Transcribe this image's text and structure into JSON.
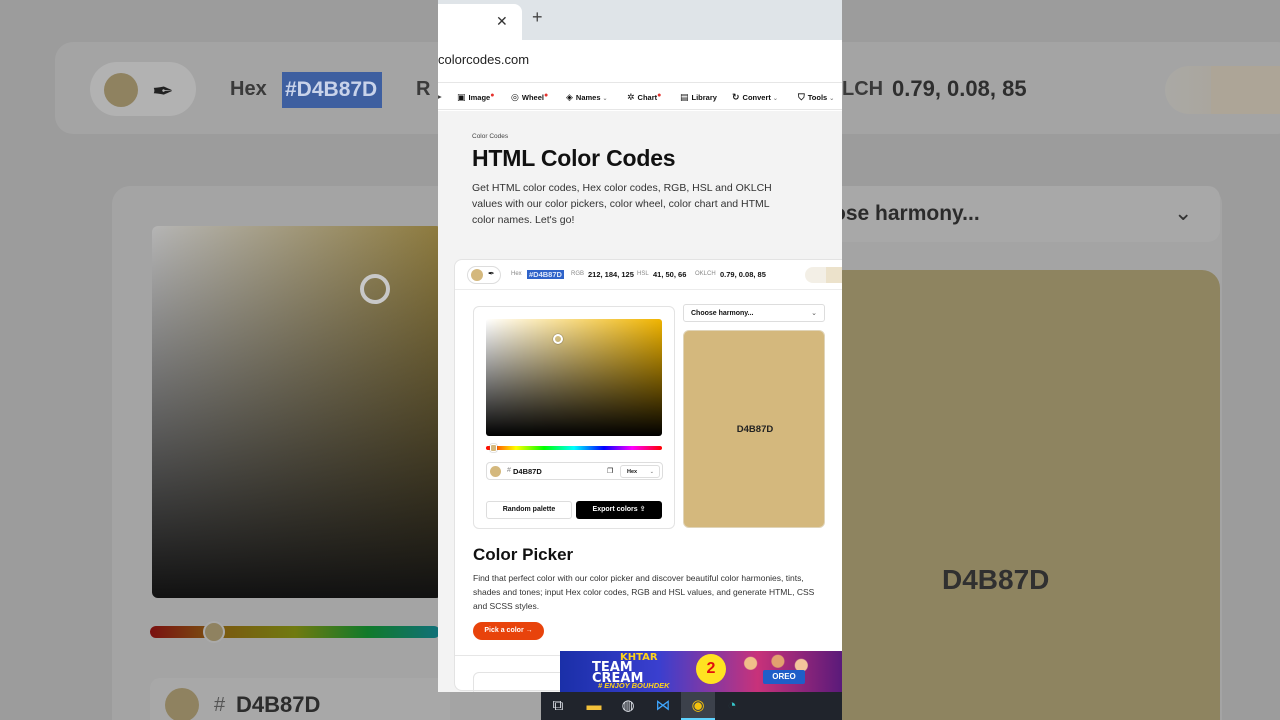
{
  "color": {
    "hex": "D4B87D",
    "hex_selected": "#D4B87D",
    "rgb": "212, 184, 125",
    "hsl": "41, 50, 66",
    "oklch": "0.79, 0.08, 85",
    "swatch": "#d4b87d"
  },
  "background": {
    "hex_label": "Hex",
    "hex_value": "#D4B87D",
    "rgb_label_partial": "R",
    "oklch_label_partial": "LCH",
    "oklch_value": "0.79, 0.08, 85",
    "harmony_partial": "ose harmony...",
    "big_label": "D4B87D",
    "hash": "#",
    "input_value": "D4B87D"
  },
  "browser": {
    "tab_close": "✕",
    "new_tab": "+",
    "url": "colorcodes.com"
  },
  "nav": {
    "items": [
      {
        "icon": "▣",
        "label": "Image",
        "dot": "●",
        "caret": ""
      },
      {
        "icon": "◎",
        "label": "Wheel",
        "dot": "●",
        "caret": ""
      },
      {
        "icon": "◈",
        "label": "Names",
        "dot": "",
        "caret": "⌄"
      },
      {
        "icon": "✲",
        "label": "Chart",
        "dot": "●",
        "caret": ""
      },
      {
        "icon": "▤",
        "label": "Library",
        "dot": "",
        "caret": ""
      },
      {
        "icon": "↻",
        "label": "Convert",
        "dot": "",
        "caret": "⌄"
      },
      {
        "icon": "⛉",
        "label": "Tools",
        "dot": "",
        "caret": "⌄"
      }
    ]
  },
  "page": {
    "breadcrumb": "Color Codes",
    "title": "HTML Color Codes",
    "lead": "Get HTML color codes, Hex color codes, RGB, HSL and OKLCH values with our color pickers, color wheel, color chart and HTML color names. Let's go!"
  },
  "toolbar": {
    "hex_label": "Hex",
    "rgb_label": "RGB",
    "hsl_label": "HSL",
    "oklch_label": "OKLCH"
  },
  "picker": {
    "hash": "#",
    "format": "Hex",
    "format_caret": "⌄",
    "random_label": "Random palette",
    "export_label": "Export colors ⇪",
    "harmony_placeholder": "Choose harmony...",
    "harmony_caret": "⌄"
  },
  "section": {
    "title": "Color Picker",
    "body": "Find that perfect color with our color picker and discover beautiful color harmonies, tints, shades and tones; input Hex color codes, RGB and HSL values, and generate HTML, CSS and SCSS styles.",
    "cta": "Pick a color →"
  },
  "ad": {
    "line1": "KHTAR",
    "line2a": "TEAM",
    "line2b": "CREAM",
    "line3": "# ENJOY BOUHDEK",
    "number": "2",
    "brand": "OREO"
  }
}
